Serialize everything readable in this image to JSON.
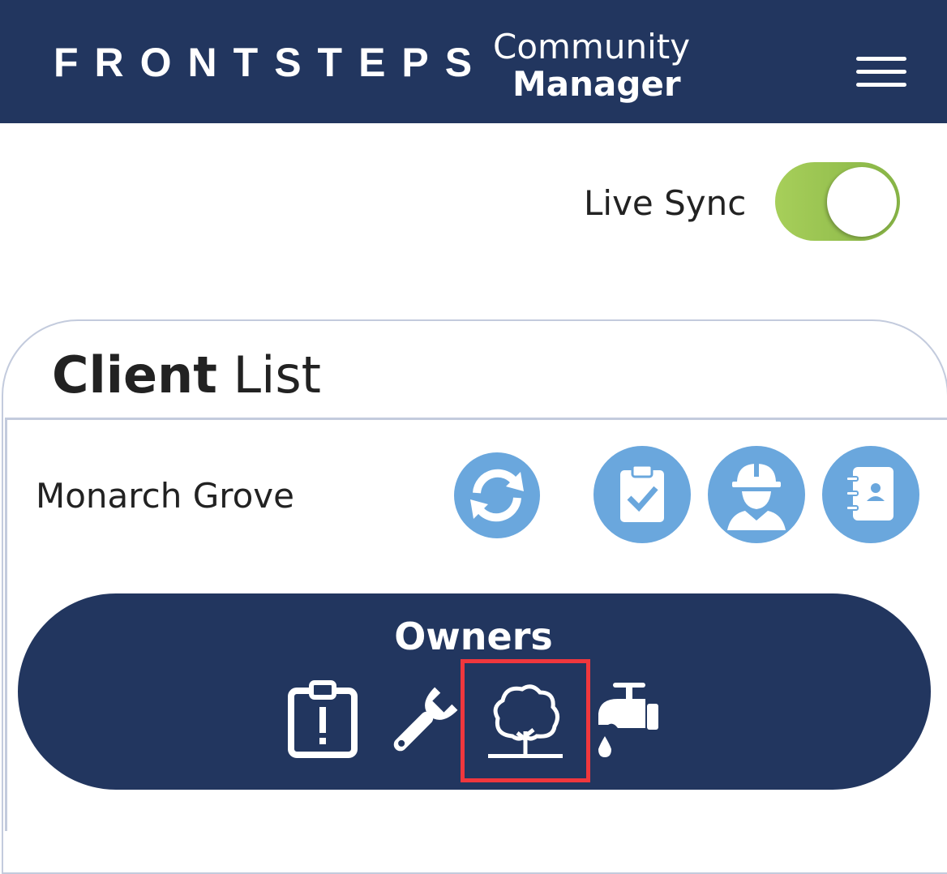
{
  "header": {
    "brand": "FRONTSTEPS",
    "product_line1": "Community",
    "product_line2": "Manager",
    "menu_icon": "hamburger-menu-icon",
    "background": "#22365f"
  },
  "live_sync": {
    "label": "Live Sync",
    "enabled": true,
    "color": "#9bc751"
  },
  "card": {
    "title_bold": "Client",
    "title_rest": " List"
  },
  "client": {
    "name": "Monarch Grove",
    "actions": [
      {
        "icon": "sync-icon"
      },
      {
        "icon": "clipboard-check-icon"
      },
      {
        "icon": "worker-hardhat-icon"
      },
      {
        "icon": "contacts-book-icon"
      }
    ],
    "accent": "#6aa7dd"
  },
  "owners": {
    "label": "Owners",
    "icons": [
      {
        "icon": "clipboard-alert-icon"
      },
      {
        "icon": "wrench-icon"
      },
      {
        "icon": "tree-icon",
        "highlighted": true
      },
      {
        "icon": "water-faucet-icon"
      }
    ],
    "highlight_color": "#f0373d"
  }
}
